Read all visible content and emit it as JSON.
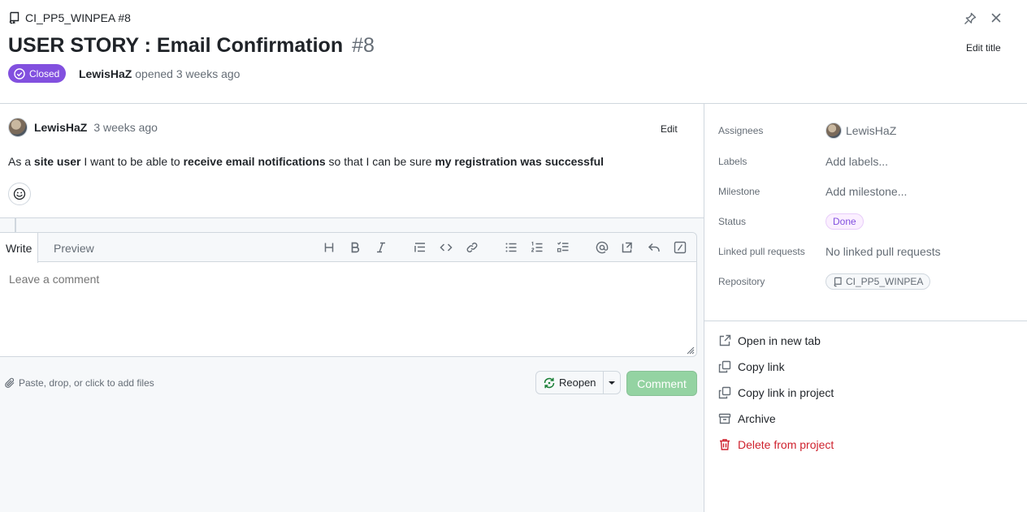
{
  "header": {
    "repo_ref": "CI_PP5_WINPEA #8",
    "title": "USER STORY : Email Confirmation",
    "number": "#8",
    "status_badge": "Closed",
    "author": "LewisHaZ",
    "opened_text": "opened 3 weeks ago",
    "edit_title_label": "Edit title"
  },
  "issue_body": {
    "author": "LewisHaZ",
    "time": "3 weeks ago",
    "edit_label": "Edit",
    "text_parts": [
      "As a ",
      "site user",
      " I want to be able to ",
      "receive email notifications",
      " so that I can be sure ",
      "my registration was successful"
    ]
  },
  "comment_editor": {
    "tab_write": "Write",
    "tab_preview": "Preview",
    "placeholder": "Leave a comment",
    "attach_hint": "Paste, drop, or click to add files",
    "reopen_label": "Reopen",
    "comment_label": "Comment"
  },
  "sidebar": {
    "assignees_label": "Assignees",
    "assignee": "LewisHaZ",
    "labels_label": "Labels",
    "labels_value": "Add labels...",
    "milestone_label": "Milestone",
    "milestone_value": "Add milestone...",
    "status_label": "Status",
    "status_value": "Done",
    "linked_label": "Linked pull requests",
    "linked_value": "No linked pull requests",
    "repository_label": "Repository",
    "repository_value": "CI_PP5_WINPEA"
  },
  "actions": {
    "open_new_tab": "Open in new tab",
    "copy_link": "Copy link",
    "copy_link_project": "Copy link in project",
    "archive": "Archive",
    "delete": "Delete from project"
  },
  "colors": {
    "closed_purple": "#8250df",
    "comment_green_disabled": "#94d3a2",
    "danger_red": "#cf222e",
    "reopen_icon_green": "#1a7f37"
  }
}
